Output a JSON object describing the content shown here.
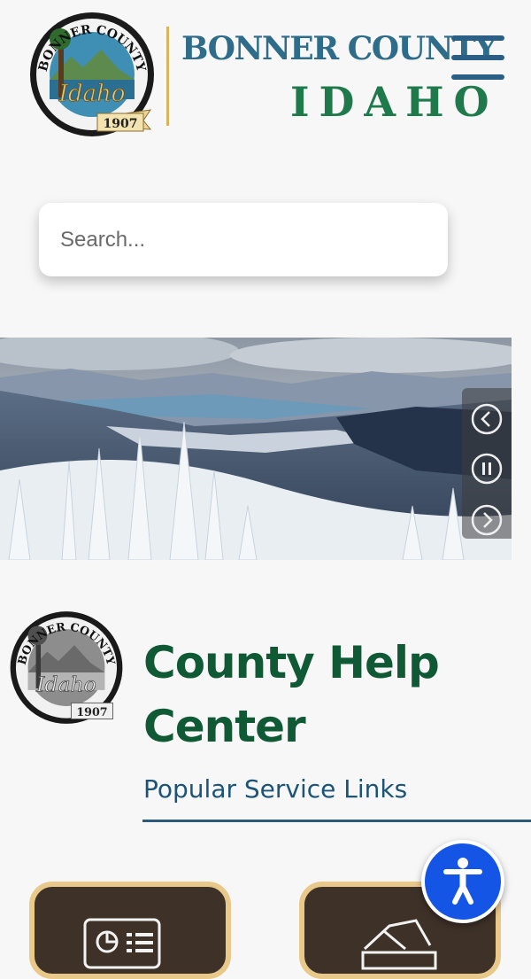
{
  "header": {
    "county_line1": "BONNER COUNTY",
    "county_line2": "IDAHO",
    "seal": {
      "ring_text": "BONNER COUNTY",
      "script_text": "Idaho",
      "year": "1907"
    }
  },
  "search": {
    "placeholder": "Search..."
  },
  "hero": {
    "controls": [
      "previous",
      "pause",
      "next"
    ]
  },
  "help_center": {
    "title": "County Help Center",
    "subtitle": "Popular Service Links"
  },
  "colors": {
    "blue_title": "#2e6c8a",
    "green_title": "#1f7a4b",
    "help_title": "#0f5a35",
    "tile_bg": "#3e3128",
    "tile_border": "#e9c98a",
    "a11y_blue": "#1455e6"
  },
  "icons": {
    "menu": "hamburger-icon",
    "prev": "chevron-left-icon",
    "pause": "pause-icon",
    "next": "chevron-right-icon",
    "accessibility": "accessibility-person-icon"
  }
}
